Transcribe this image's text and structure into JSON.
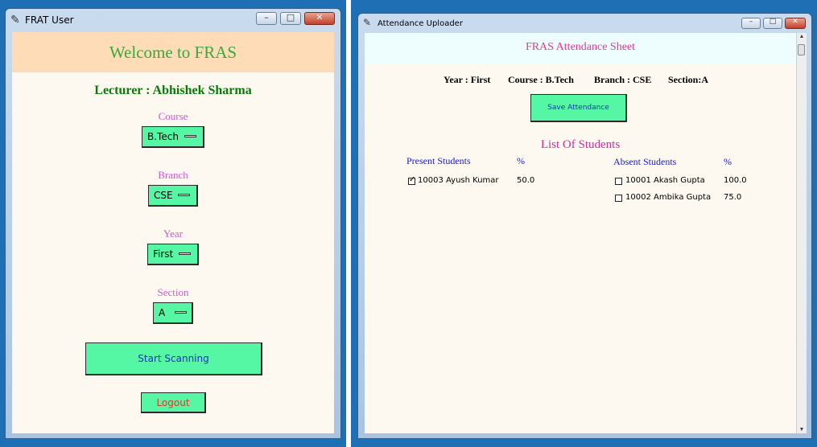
{
  "frat": {
    "window_title": "FRAT User",
    "welcome": "Welcome to FRAS",
    "lecturer": "Lecturer : Abhishek Sharma",
    "course": {
      "label": "Course",
      "value": "B.Tech"
    },
    "branch": {
      "label": "Branch",
      "value": "CSE"
    },
    "year": {
      "label": "Year",
      "value": "First"
    },
    "section": {
      "label": "Section",
      "value": "A"
    },
    "start_scanning": "Start Scanning",
    "logout": "Logout",
    "colors": {
      "welcome_bg": "#ffdcb8",
      "welcome_text": "#3aa83a",
      "button_bg": "#55f7a4",
      "label": "#d05ad0",
      "lecturer_text": "#0a7a0a",
      "logout_text": "#d93a2b"
    }
  },
  "uploader": {
    "window_title": "Attendance Uploader",
    "header": "FRAS Attendance Sheet",
    "info": {
      "year": "Year : First",
      "course": "Course : B.Tech",
      "branch": "Branch : CSE",
      "section": "Section:A"
    },
    "save_button": "Save Attendance",
    "list_title": "List Of Students",
    "present_header": "Present Students",
    "absent_header": "Absent Students",
    "percent_header": "%",
    "present": [
      {
        "text": "10003 Ayush Kumar",
        "percent": "50.0",
        "checked": true
      }
    ],
    "absent": [
      {
        "text": "10001 Akash Gupta",
        "percent": "100.0",
        "checked": false
      },
      {
        "text": "10002 Ambika Gupta",
        "percent": "75.0",
        "checked": false
      }
    ],
    "colors": {
      "header_bg": "#eefefe",
      "header_text": "#e0389a",
      "list_title": "#d0309a",
      "column_header": "#1a1ad8"
    }
  }
}
